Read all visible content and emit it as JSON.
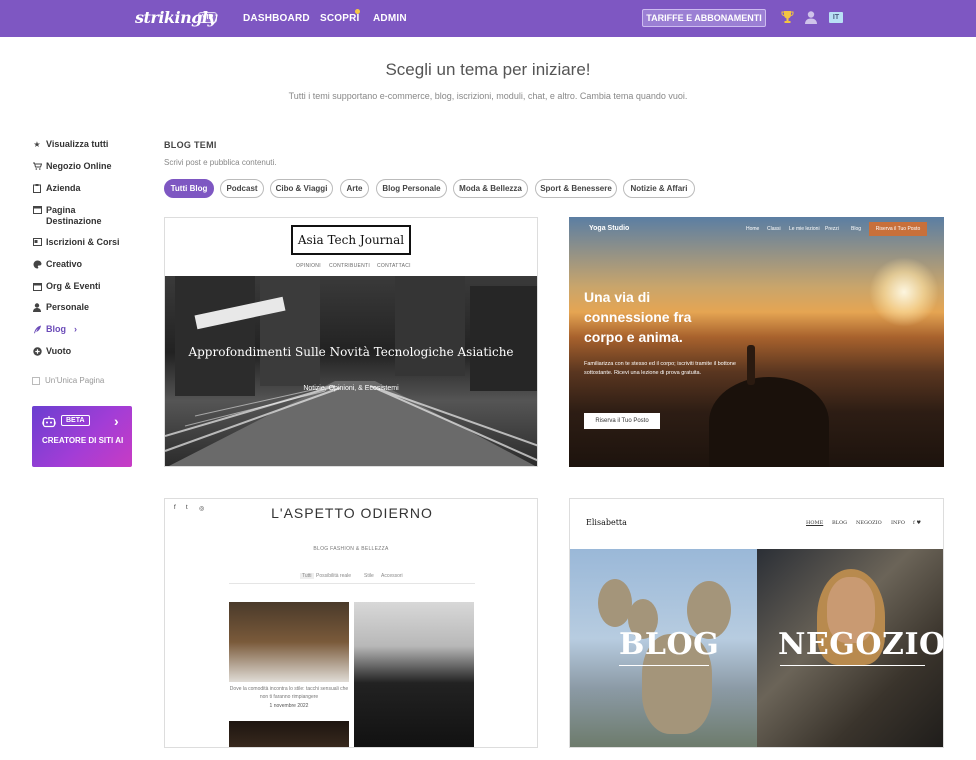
{
  "topbar": {
    "logo": "strikingly",
    "vip": "VIP",
    "nav": [
      "DASHBOARD",
      "SCOPRI",
      "ADMIN"
    ],
    "pricing": "TARIFFE E ABBONAMENTI",
    "lang": "IT",
    "accent": "#7e57c2"
  },
  "hero": {
    "title": "Scegli un tema per iniziare!",
    "subtitle": "Tutti i temi supportano e-commerce, blog, iscrizioni, moduli, chat, e altro. Cambia tema quando vuoi."
  },
  "sidebar": {
    "items": [
      {
        "icon": "star-icon",
        "label": "Visualizza tutti"
      },
      {
        "icon": "cart-icon",
        "label": "Negozio Online"
      },
      {
        "icon": "clipboard-icon",
        "label": "Azienda"
      },
      {
        "icon": "window-icon",
        "label": "Pagina Destinazione"
      },
      {
        "icon": "card-icon",
        "label": "Iscrizioni & Corsi"
      },
      {
        "icon": "palette-icon",
        "label": "Creativo"
      },
      {
        "icon": "calendar-icon",
        "label": "Org & Eventi"
      },
      {
        "icon": "person-icon",
        "label": "Personale"
      },
      {
        "icon": "quill-icon",
        "label": "Blog"
      },
      {
        "icon": "plus-circle-icon",
        "label": "Vuoto"
      }
    ],
    "single_page": "Un'Unica Pagina",
    "ai": {
      "beta": "BETA",
      "title": "CREATORE DI SITI AI"
    }
  },
  "section": {
    "title": "BLOG TEMI",
    "subtitle": "Scrivi post e pubblica contenuti.",
    "filters": [
      "Tutti Blog",
      "Podcast",
      "Cibo & Viaggi",
      "Arte",
      "Blog Personale",
      "Moda & Bellezza",
      "Sport & Benessere",
      "Notizie & Affari"
    ]
  },
  "cards": {
    "c1": {
      "logo": "Asia Tech Journal",
      "menu": [
        "OPINIONI",
        "CONTRIBUENTI",
        "CONTATTACI"
      ],
      "headline": "Approfondimenti Sulle Novità Tecnologiche Asiatiche",
      "tagline": "Notizie, Opinioni, & Ecosistemi"
    },
    "c2": {
      "brand": "Yoga Studio",
      "menu": [
        "Home",
        "Classi",
        "Le mie lezioni",
        "Prezzi",
        "Blog"
      ],
      "book": "Riserva il Tuo Posto",
      "headline": "Una via di connessione fra corpo e anima.",
      "text": "Familiarizza con te stesso ed il corpo; iscriviti tramite il bottone sottostante. Ricevi una lezione di prova gratuita.",
      "button": "Riserva il Tuo Posto"
    },
    "c3": {
      "social": [
        "f",
        "t",
        "◎"
      ],
      "title": "L'ASPETTO ODIERNO",
      "subtitle": "BLOG FASHION & BELLEZZA",
      "filters": [
        "Tutti",
        "Possibilità reale",
        "Stile",
        "Accessori"
      ],
      "caption": "Dove la comodità incontra lo stile: tacchi sensuali che non ti faranno rimpiangere",
      "date": "1 novembre 2022"
    },
    "c4": {
      "brand": "Elisabetta",
      "menu": [
        "HOME",
        "BLOG",
        "NEGOZIO",
        "INFO",
        "f ♥"
      ],
      "left_label": "BLOG",
      "right_label": "NEGOZIO"
    }
  }
}
